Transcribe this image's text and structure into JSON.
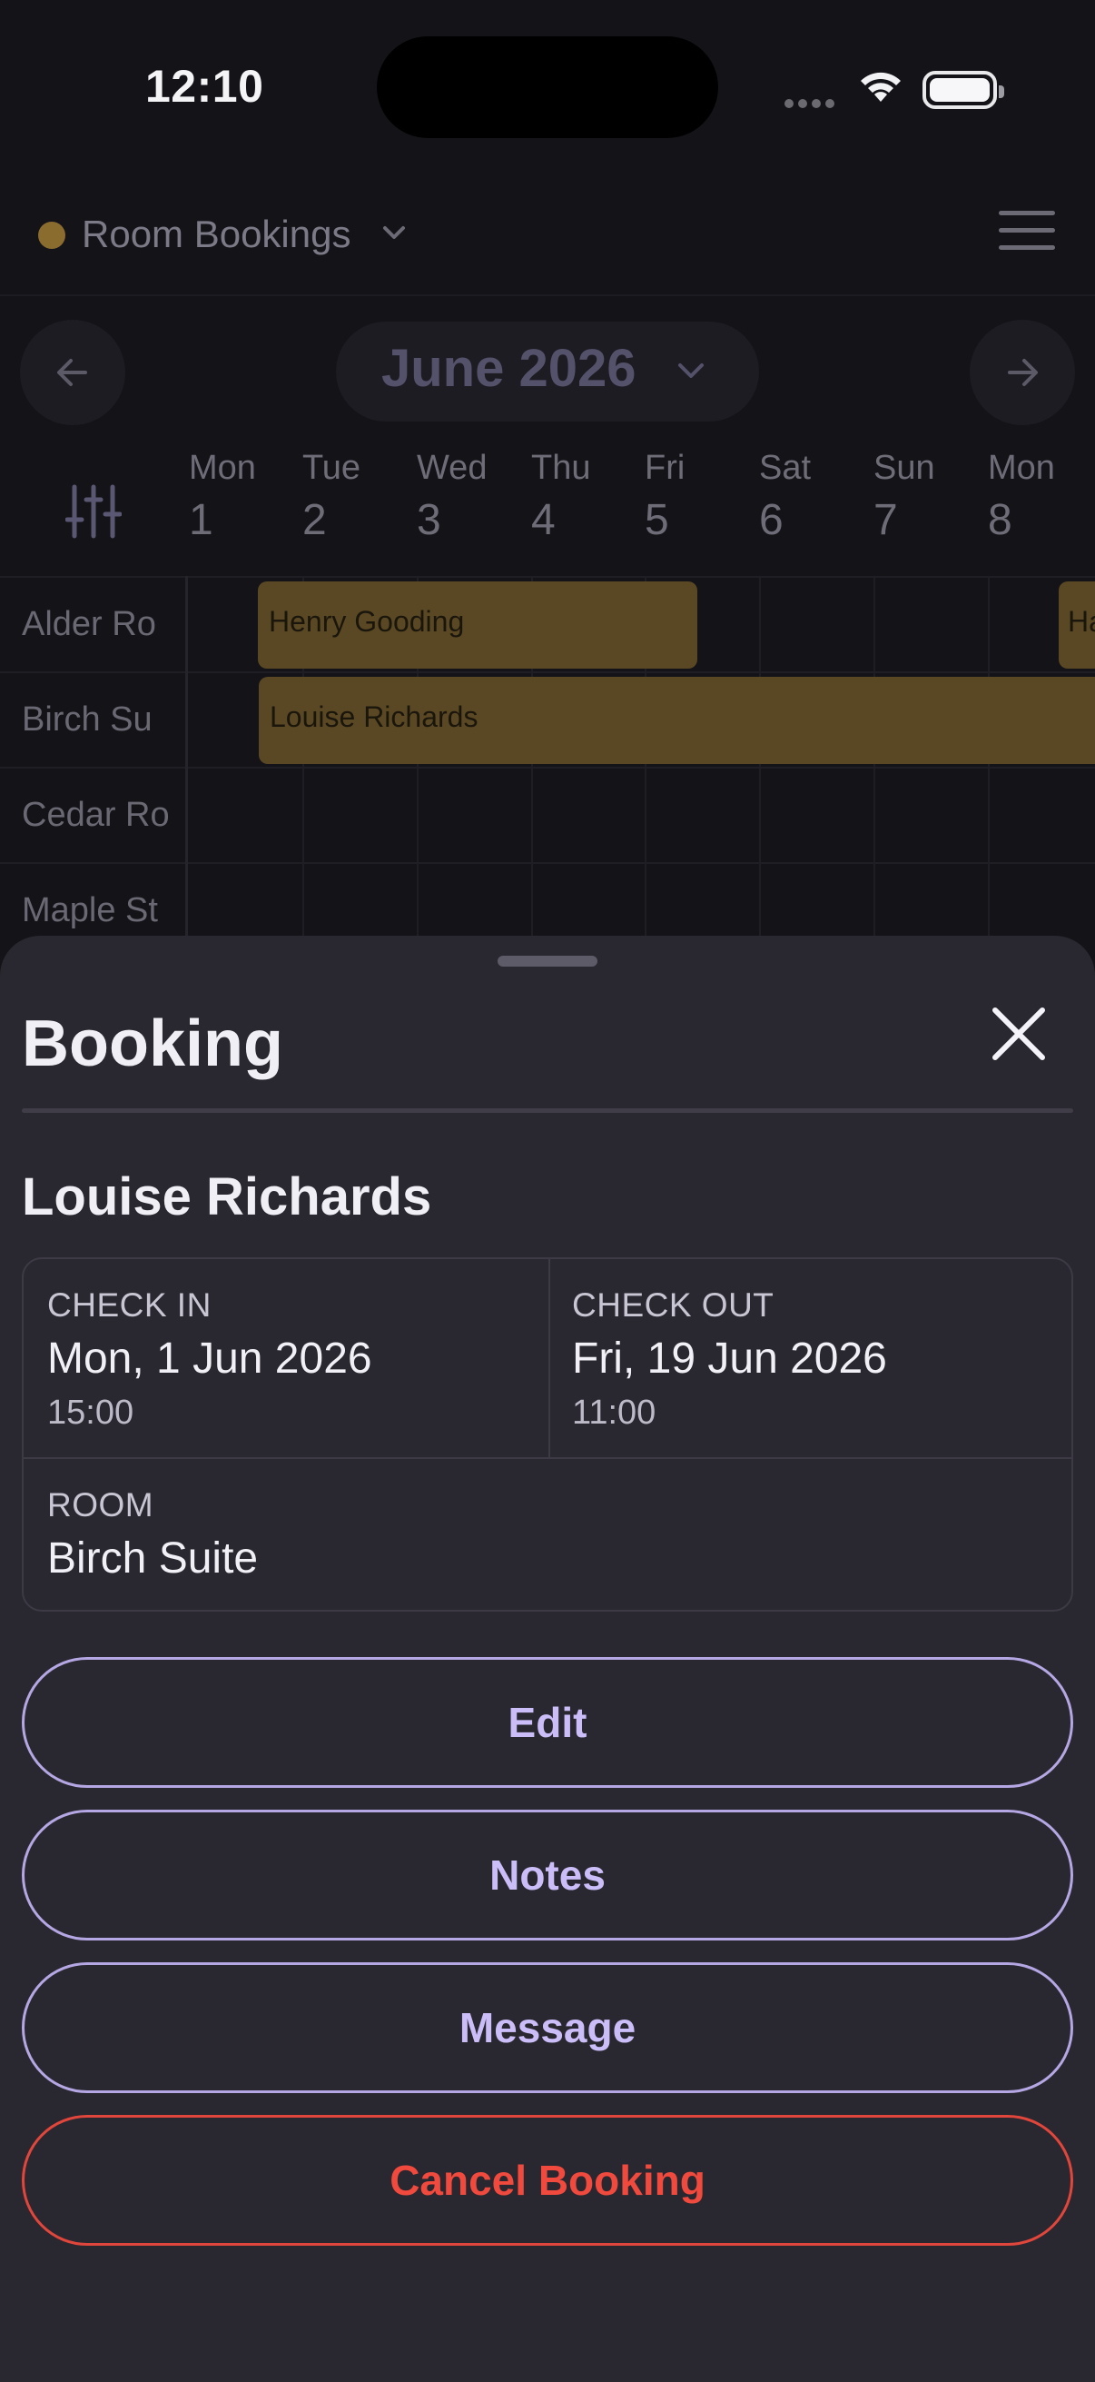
{
  "status_bar": {
    "time": "12:10"
  },
  "header": {
    "title": "Room Bookings"
  },
  "calendar": {
    "month_label": "June 2026",
    "days": [
      {
        "name": "Mon",
        "date": "1"
      },
      {
        "name": "Tue",
        "date": "2"
      },
      {
        "name": "Wed",
        "date": "3"
      },
      {
        "name": "Thu",
        "date": "4"
      },
      {
        "name": "Fri",
        "date": "5"
      },
      {
        "name": "Sat",
        "date": "6"
      },
      {
        "name": "Sun",
        "date": "7"
      },
      {
        "name": "Mon",
        "date": "8"
      }
    ],
    "rooms": [
      "Alder Ro",
      "Birch Su",
      "Cedar Ro",
      "Maple St"
    ],
    "bookings": [
      {
        "guest": "Henry Gooding"
      },
      {
        "guest": "Louise Richards"
      },
      {
        "guest": "Ha"
      }
    ]
  },
  "sheet": {
    "title": "Booking",
    "guest_name": "Louise Richards",
    "check_in": {
      "label": "CHECK IN",
      "date": "Mon, 1 Jun 2026",
      "time": "15:00"
    },
    "check_out": {
      "label": "CHECK OUT",
      "date": "Fri, 19 Jun 2026",
      "time": "11:00"
    },
    "room": {
      "label": "ROOM",
      "value": "Birch Suite"
    },
    "actions": {
      "edit": "Edit",
      "notes": "Notes",
      "message": "Message",
      "cancel": "Cancel Booking"
    }
  },
  "colors": {
    "accent": "#cbbdf7",
    "danger": "#f0493d",
    "booking": "#5a4824",
    "sheet_bg": "#29272f"
  }
}
